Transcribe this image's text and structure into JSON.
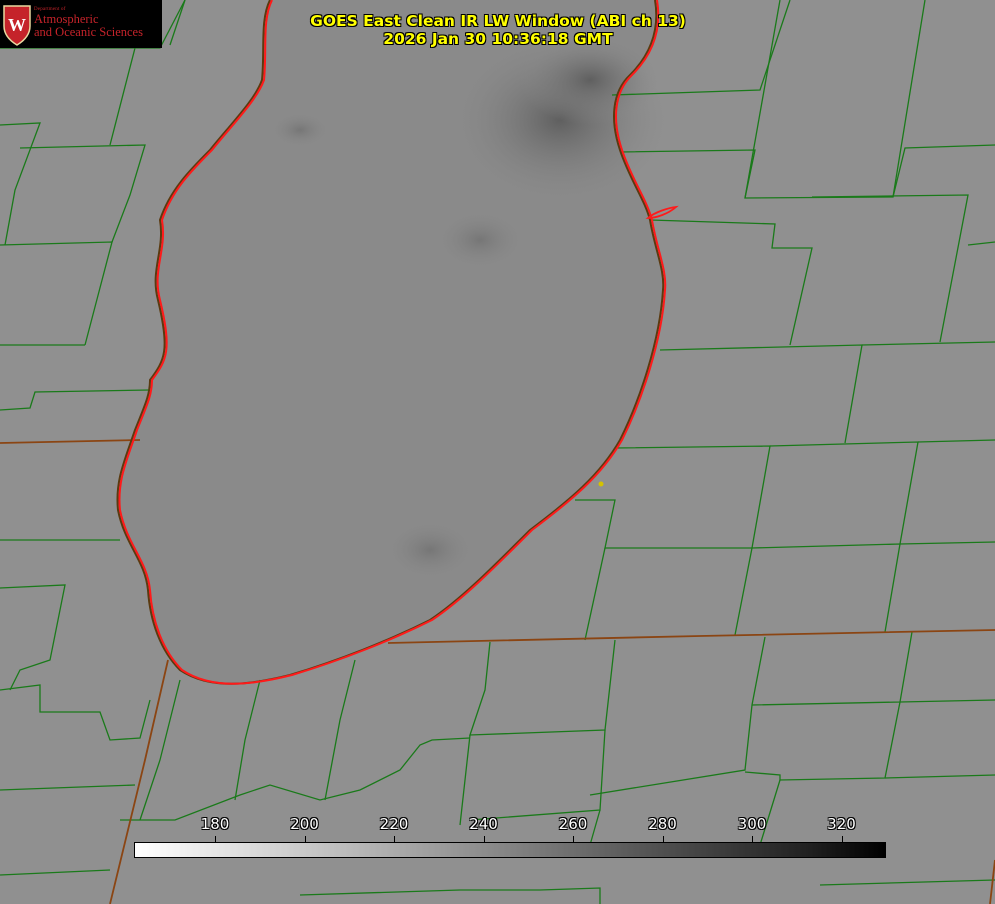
{
  "title": {
    "main": "GOES East Clean IR LW Window (ABI ch 13)",
    "timestamp": "2026 Jan 30 10:36:18 GMT"
  },
  "logo": {
    "department": "Department of",
    "line1": "Atmospheric",
    "line2": "and Oceanic Sciences",
    "crest_letter": "W"
  },
  "colorbar": {
    "ticks": [
      "180",
      "200",
      "220",
      "240",
      "260",
      "280",
      "300",
      "320"
    ],
    "colormap": "white-to-black"
  },
  "colors": {
    "county_lines": "#1a7a1a",
    "state_lines": "#8b4513",
    "coastline": "#ff0000",
    "title_text": "#ffff00",
    "logo_red": "#c5232a"
  }
}
